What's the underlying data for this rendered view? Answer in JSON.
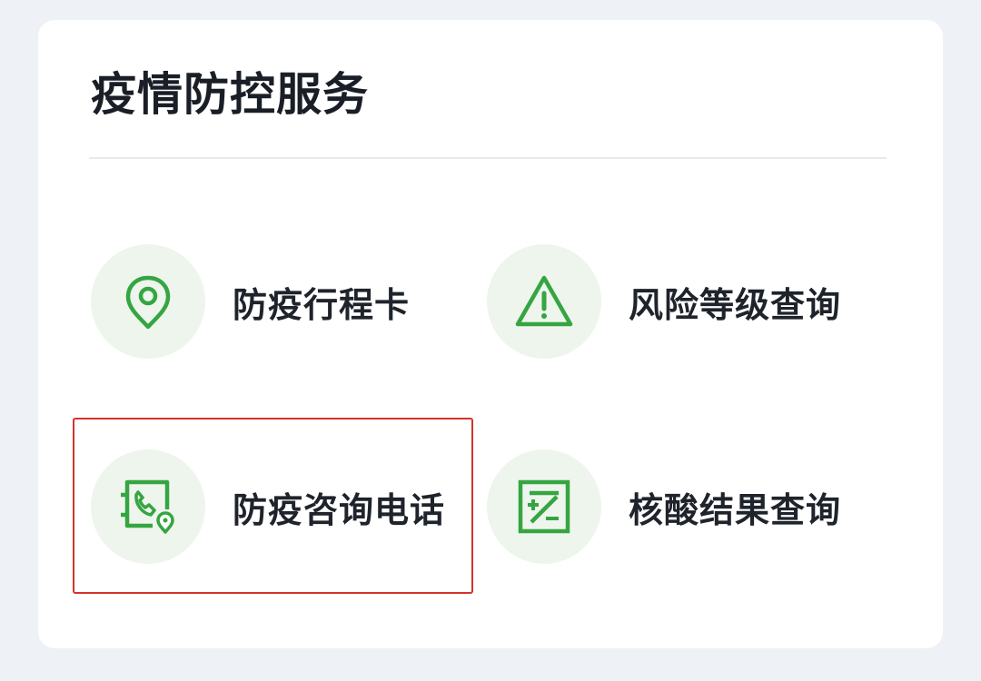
{
  "card": {
    "title": "疫情防控服务"
  },
  "items": [
    {
      "label": "防疫行程卡",
      "icon": "location-pin-icon"
    },
    {
      "label": "风险等级查询",
      "icon": "warning-triangle-icon"
    },
    {
      "label": "防疫咨询电话",
      "icon": "phone-location-icon"
    },
    {
      "label": "核酸结果查询",
      "icon": "test-result-icon"
    }
  ],
  "colors": {
    "accent_green": "#35a542",
    "icon_bg": "#eef5ec",
    "highlight_red": "#d3332c"
  }
}
